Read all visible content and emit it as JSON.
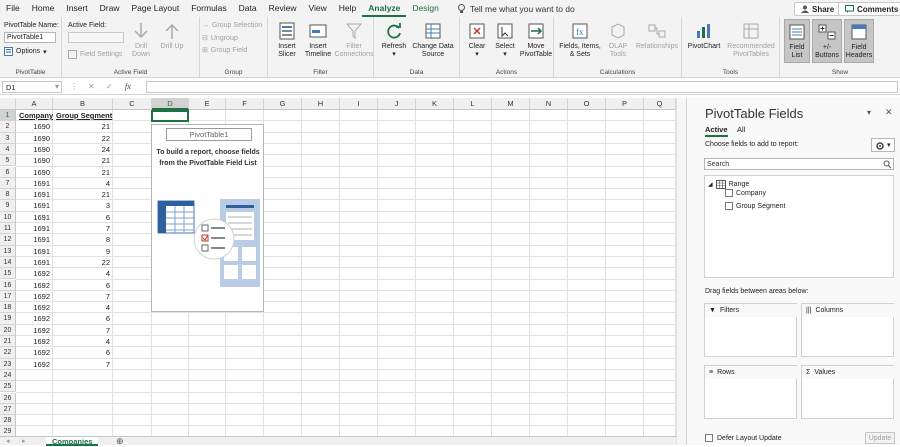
{
  "menu": {
    "items": [
      "File",
      "Home",
      "Insert",
      "Draw",
      "Page Layout",
      "Formulas",
      "Data",
      "Review",
      "View",
      "Help",
      "Analyze",
      "Design"
    ],
    "active": "Analyze",
    "tell_me": "Tell me what you want to do",
    "share": "Share",
    "comments": "Comments"
  },
  "ribbon": {
    "pivottable": {
      "name_label": "PivotTable Name:",
      "name_value": "PivotTable1",
      "options": "Options",
      "group": "PivotTable"
    },
    "active_field": {
      "label": "Active Field:",
      "field_settings": "Field Settings",
      "drill_down": "Drill Down",
      "drill_up": "Drill Up",
      "group": "Active Field"
    },
    "group": {
      "selection": "Group Selection",
      "ungroup": "Ungroup",
      "field": "Group Field",
      "group": "Group"
    },
    "filter": {
      "slicer": "Insert Slicer",
      "timeline": "Insert Timeline",
      "connections": "Filter Connections",
      "group": "Filter"
    },
    "data": {
      "refresh": "Refresh",
      "change_source": "Change Data Source",
      "group": "Data"
    },
    "actions": {
      "clear": "Clear",
      "select": "Select",
      "move": "Move PivotTable",
      "group": "Actions"
    },
    "calculations": {
      "fields": "Fields, Items, & Sets",
      "olap": "OLAP Tools",
      "relationships": "Relationships",
      "group": "Calculations"
    },
    "tools": {
      "pivotchart": "PivotChart",
      "recommended": "Recommended PivotTables",
      "group": "Tools"
    },
    "show": {
      "field_list": "Field List",
      "buttons": "+/- Buttons",
      "headers": "Field Headers",
      "group": "Show"
    }
  },
  "formula_bar": {
    "name_box": "D1",
    "fx": "fx"
  },
  "sheet": {
    "columns": [
      "A",
      "B",
      "C",
      "D",
      "E",
      "F",
      "G",
      "H",
      "I",
      "J",
      "K",
      "L",
      "M",
      "N",
      "O",
      "P",
      "Q"
    ],
    "headers": [
      "Company",
      "Group Segment"
    ],
    "rows": [
      [
        "1690",
        "21"
      ],
      [
        "1690",
        "22"
      ],
      [
        "1690",
        "24"
      ],
      [
        "1690",
        "21"
      ],
      [
        "1690",
        "21"
      ],
      [
        "1691",
        "4"
      ],
      [
        "1691",
        "21"
      ],
      [
        "1691",
        "3"
      ],
      [
        "1691",
        "6"
      ],
      [
        "1691",
        "7"
      ],
      [
        "1691",
        "8"
      ],
      [
        "1691",
        "9"
      ],
      [
        "1691",
        "22"
      ],
      [
        "1692",
        "4"
      ],
      [
        "1692",
        "6"
      ],
      [
        "1692",
        "7"
      ],
      [
        "1692",
        "4"
      ],
      [
        "1692",
        "6"
      ],
      [
        "1692",
        "7"
      ],
      [
        "1692",
        "4"
      ],
      [
        "1692",
        "6"
      ],
      [
        "1692",
        "7"
      ]
    ],
    "row_count": 29,
    "pivot_name": "PivotTable1",
    "pivot_instruction": "To build a report, choose fields from the PivotTable Field List",
    "tab": "Companies"
  },
  "panel": {
    "title": "PivotTable Fields",
    "tabs": [
      "Active",
      "All"
    ],
    "choose_label": "Choose fields to add to report:",
    "search_placeholder": "Search",
    "range_label": "Range",
    "fields": [
      "Company",
      "Group Segment"
    ],
    "drag_label": "Drag fields between areas below:",
    "areas": {
      "filters": "Filters",
      "columns": "Columns",
      "rows": "Rows",
      "values": "Values"
    },
    "defer": "Defer Layout Update",
    "update": "Update"
  },
  "colors": {
    "accent": "#1e7145"
  }
}
